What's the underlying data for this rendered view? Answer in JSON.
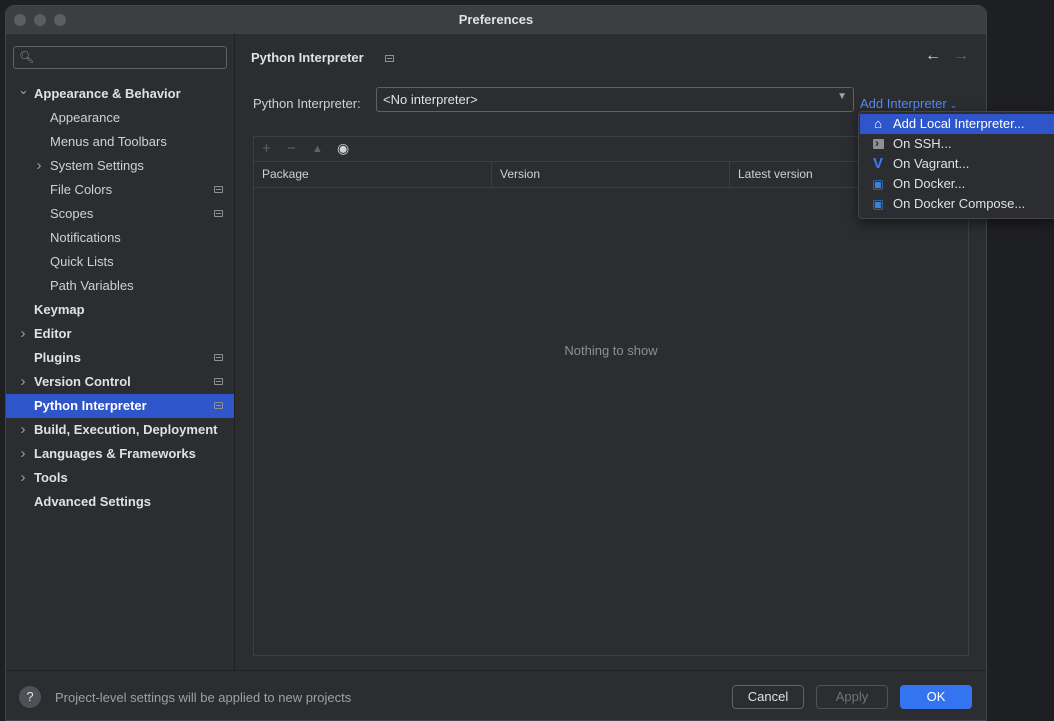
{
  "window": {
    "title": "Preferences"
  },
  "sidebar": {
    "search_placeholder": "",
    "items": [
      {
        "label": "Appearance & Behavior",
        "bold": true,
        "chevron": "expanded",
        "level": 0,
        "project": false
      },
      {
        "label": "Appearance",
        "bold": false,
        "chevron": "none",
        "level": 1,
        "project": false
      },
      {
        "label": "Menus and Toolbars",
        "bold": false,
        "chevron": "none",
        "level": 1,
        "project": false
      },
      {
        "label": "System Settings",
        "bold": false,
        "chevron": "collapsed",
        "level": 1,
        "project": false
      },
      {
        "label": "File Colors",
        "bold": false,
        "chevron": "none",
        "level": 1,
        "project": true
      },
      {
        "label": "Scopes",
        "bold": false,
        "chevron": "none",
        "level": 1,
        "project": true
      },
      {
        "label": "Notifications",
        "bold": false,
        "chevron": "none",
        "level": 1,
        "project": false
      },
      {
        "label": "Quick Lists",
        "bold": false,
        "chevron": "none",
        "level": 1,
        "project": false
      },
      {
        "label": "Path Variables",
        "bold": false,
        "chevron": "none",
        "level": 1,
        "project": false
      },
      {
        "label": "Keymap",
        "bold": true,
        "chevron": "none",
        "level": 0,
        "project": false
      },
      {
        "label": "Editor",
        "bold": true,
        "chevron": "collapsed",
        "level": 0,
        "project": false
      },
      {
        "label": "Plugins",
        "bold": true,
        "chevron": "none",
        "level": 0,
        "project": true
      },
      {
        "label": "Version Control",
        "bold": true,
        "chevron": "collapsed",
        "level": 0,
        "project": true
      },
      {
        "label": "Python Interpreter",
        "bold": true,
        "chevron": "none",
        "level": 0,
        "project": true,
        "selected": true
      },
      {
        "label": "Build, Execution, Deployment",
        "bold": true,
        "chevron": "collapsed",
        "level": 0,
        "project": false
      },
      {
        "label": "Languages & Frameworks",
        "bold": true,
        "chevron": "collapsed",
        "level": 0,
        "project": false
      },
      {
        "label": "Tools",
        "bold": true,
        "chevron": "collapsed",
        "level": 0,
        "project": false
      },
      {
        "label": "Advanced Settings",
        "bold": true,
        "chevron": "none",
        "level": 0,
        "project": false
      }
    ]
  },
  "main": {
    "title": "Python Interpreter",
    "interpreter_label": "Python Interpreter:",
    "interpreter_value": "<No interpreter>",
    "add_interpreter": "Add Interpreter",
    "columns": [
      "Package",
      "Version",
      "Latest version"
    ],
    "empty_text": "Nothing to show"
  },
  "popup": {
    "items": [
      {
        "label": "Add Local Interpreter...",
        "icon": "home-icon",
        "selected": true
      },
      {
        "label": "On SSH...",
        "icon": "terminal-icon",
        "selected": false
      },
      {
        "label": "On Vagrant...",
        "icon": "vagrant-icon",
        "selected": false
      },
      {
        "label": "On Docker...",
        "icon": "docker-icon",
        "selected": false
      },
      {
        "label": "On Docker Compose...",
        "icon": "docker-icon",
        "selected": false
      }
    ]
  },
  "footer": {
    "help": "?",
    "text": "Project-level settings will be applied to new projects",
    "cancel": "Cancel",
    "apply": "Apply",
    "ok": "OK"
  },
  "colors": {
    "accent": "#3574f0",
    "selection": "#2e55c9",
    "link": "#548af7",
    "background": "#2b2d30"
  }
}
